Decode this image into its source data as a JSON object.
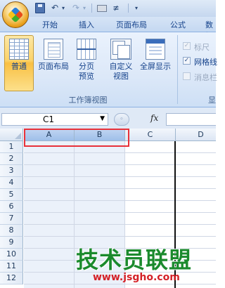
{
  "qat": {
    "undo_icon": "undo-icon",
    "redo_icon": "redo-icon"
  },
  "tabs": [
    "开始",
    "插入",
    "页面布局",
    "公式",
    "数据"
  ],
  "ribbon": {
    "buttons": [
      {
        "label": "普通",
        "active": true,
        "icon": "normal-view-icon"
      },
      {
        "label": "页面布局",
        "active": false,
        "icon": "page-layout-view-icon"
      },
      {
        "label": "分页\n预览",
        "active": false,
        "icon": "page-break-preview-icon"
      },
      {
        "label": "自定义\n视图",
        "active": false,
        "icon": "custom-views-icon"
      },
      {
        "label": "全屏显示",
        "active": false,
        "icon": "full-screen-icon"
      }
    ],
    "group_label": "工作簿视图",
    "right_group_label": "显",
    "checkboxes": [
      {
        "label": "标尺",
        "checked": true,
        "enabled": false
      },
      {
        "label": "网格线",
        "checked": true,
        "enabled": true
      },
      {
        "label": "消息栏",
        "checked": false,
        "enabled": false
      }
    ]
  },
  "formula_bar": {
    "name_box": "C1",
    "fx": "fx",
    "formula": ""
  },
  "sheet": {
    "columns": [
      "A",
      "B",
      "C",
      "D"
    ],
    "selected_columns": [
      "A",
      "B"
    ],
    "rows": [
      "1",
      "2",
      "3",
      "4",
      "5",
      "6",
      "7",
      "8",
      "9",
      "10",
      "11",
      "12"
    ]
  },
  "watermark": {
    "text": "技术员联盟",
    "url": "www.jsgho.com"
  },
  "colors": {
    "ribbon_active": "#f9c044",
    "highlight_border": "#e8313a",
    "watermark_green": "#1b8a2d",
    "watermark_red": "#d42127"
  }
}
